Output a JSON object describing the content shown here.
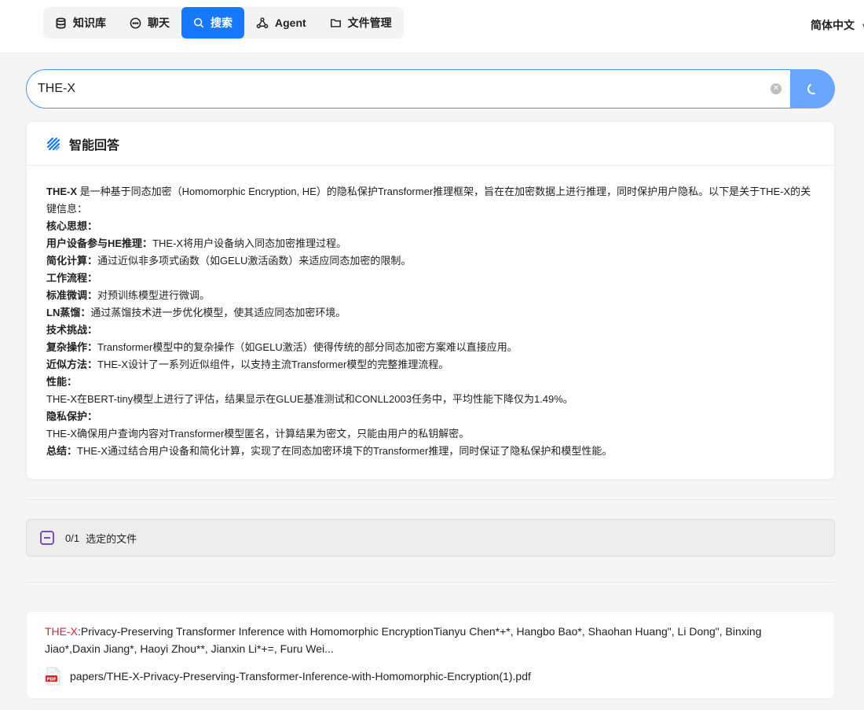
{
  "nav": {
    "items": [
      {
        "label": "知识库",
        "icon": "database-icon",
        "active": false
      },
      {
        "label": "聊天",
        "icon": "chat-icon",
        "active": false
      },
      {
        "label": "搜索",
        "icon": "search-icon",
        "active": true
      },
      {
        "label": "Agent",
        "icon": "agent-icon",
        "active": false
      },
      {
        "label": "文件管理",
        "icon": "folder-icon",
        "active": false
      }
    ],
    "language": "简体中文"
  },
  "search": {
    "value": "THE-X"
  },
  "answer": {
    "title": "智能回答",
    "intro_bold": "THE-X",
    "intro_text": " 是一种基于同态加密（Homomorphic Encryption, HE）的隐私保护Transformer推理框架，旨在在加密数据上进行推理，同时保护用户隐私。以下是关于THE-X的关键信息：",
    "lines": [
      {
        "bold": "核心思想：",
        "text": ""
      },
      {
        "bold": "用户设备参与HE推理：",
        "text": "THE-X将用户设备纳入同态加密推理过程。"
      },
      {
        "bold": "简化计算：",
        "text": "通过近似非多项式函数（如GELU激活函数）来适应同态加密的限制。"
      },
      {
        "bold": "工作流程：",
        "text": ""
      },
      {
        "bold": "标准微调：",
        "text": "对预训练模型进行微调。"
      },
      {
        "bold": "LN蒸馏：",
        "text": "通过蒸馏技术进一步优化模型，使其适应同态加密环境。"
      },
      {
        "bold": "技术挑战：",
        "text": ""
      },
      {
        "bold": "复杂操作：",
        "text": "Transformer模型中的复杂操作（如GELU激活）使得传统的部分同态加密方案难以直接应用。"
      },
      {
        "bold": "近似方法：",
        "text": "THE-X设计了一系列近似组件，以支持主流Transformer模型的完整推理流程。"
      },
      {
        "bold": "性能：",
        "text": ""
      },
      {
        "bold": "",
        "text": "THE-X在BERT-tiny模型上进行了评估，结果显示在GLUE基准测试和CONLL2003任务中，平均性能下降仅为1.49%。"
      },
      {
        "bold": "隐私保护：",
        "text": ""
      },
      {
        "bold": "",
        "text": "THE-X确保用户查询内容对Transformer模型匿名，计算结果为密文，只能由用户的私钥解密。"
      },
      {
        "bold": "总结：",
        "text": "THE-X通过结合用户设备和简化计算，实现了在同态加密环境下的Transformer推理，同时保证了隐私保护和模型性能。"
      }
    ]
  },
  "selection": {
    "count": "0/1",
    "label": "选定的文件"
  },
  "results": [
    {
      "highlight": "THE-X",
      "text": ":Privacy-Preserving Transformer Inference with Homomorphic EncryptionTianyu Chen*+*, Hangbo Bao*, Shaohan Huang\", Li Dong\", Binxing Jiao*,Daxin Jiang*, Haoyi Zhou**, Jianxin Li*+=, Furu Wei...",
      "file": "papers/THE-X-Privacy-Preserving-Transformer-Inference-with-Homomorphic-Encryption(1).pdf",
      "file_icon": "pdf-icon"
    }
  ],
  "colors": {
    "accent": "#1677ff",
    "highlight": "#e02424",
    "checkbox": "#7b4fc4"
  }
}
